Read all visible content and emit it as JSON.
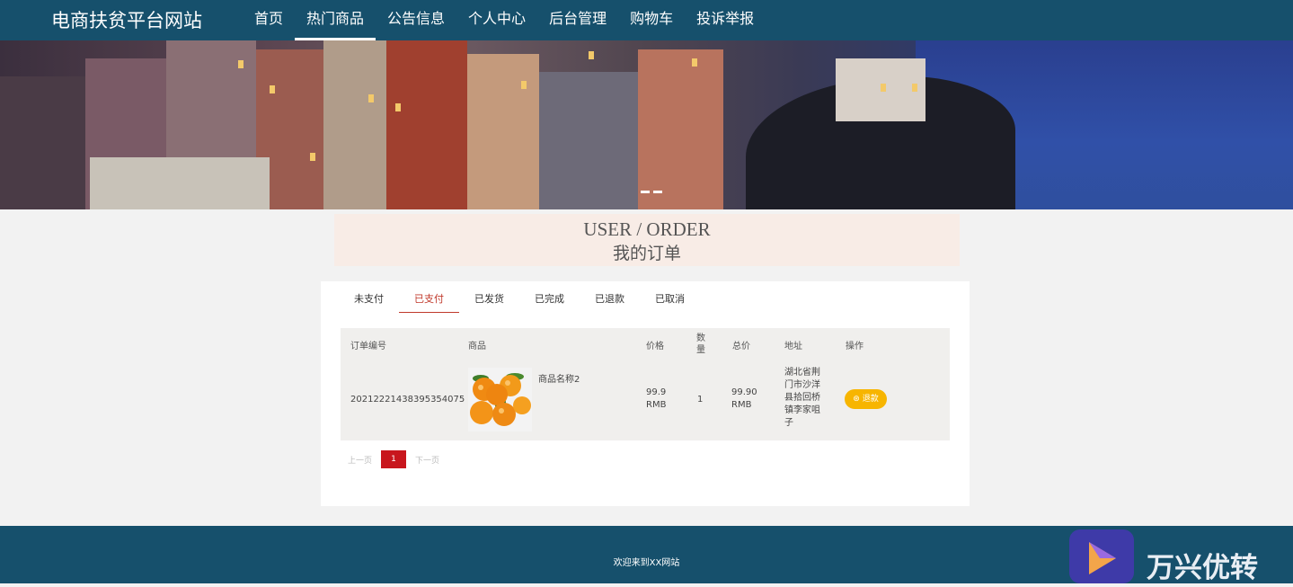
{
  "site": {
    "title": "电商扶贫平台网站"
  },
  "nav": {
    "items": [
      {
        "label": "首页"
      },
      {
        "label": "热门商品"
      },
      {
        "label": "公告信息"
      },
      {
        "label": "个人中心"
      },
      {
        "label": "后台管理"
      },
      {
        "label": "购物车"
      },
      {
        "label": "投诉举报"
      }
    ],
    "active_index": 1
  },
  "order_header": {
    "english": "USER / ORDER",
    "chinese": "我的订单"
  },
  "tabs": {
    "items": [
      {
        "label": "未支付"
      },
      {
        "label": "已支付"
      },
      {
        "label": "已发货"
      },
      {
        "label": "已完成"
      },
      {
        "label": "已退款"
      },
      {
        "label": "已取消"
      }
    ],
    "active_index": 1
  },
  "table": {
    "headers": [
      "订单编号",
      "商品",
      "价格",
      "数量",
      "总价",
      "地址",
      "操作"
    ],
    "rows": [
      {
        "order_no": "20212221438395354075",
        "product_name": "商品名称2",
        "price": "99.9\nRMB",
        "qty": "1",
        "total": "99.90\nRMB",
        "address": "湖北省荆门市沙洋县拾回桥镇李家咀子",
        "action": "退款"
      }
    ]
  },
  "pager": {
    "prev": "上一页",
    "current": "1",
    "next": "下一页"
  },
  "footer": {
    "text": "欢迎来到XX网站"
  },
  "watermark": {
    "text": "万兴优转"
  },
  "colors": {
    "header_bg": "#16506c",
    "accent_red": "#c8161d",
    "pay_button": "#f7b500"
  }
}
